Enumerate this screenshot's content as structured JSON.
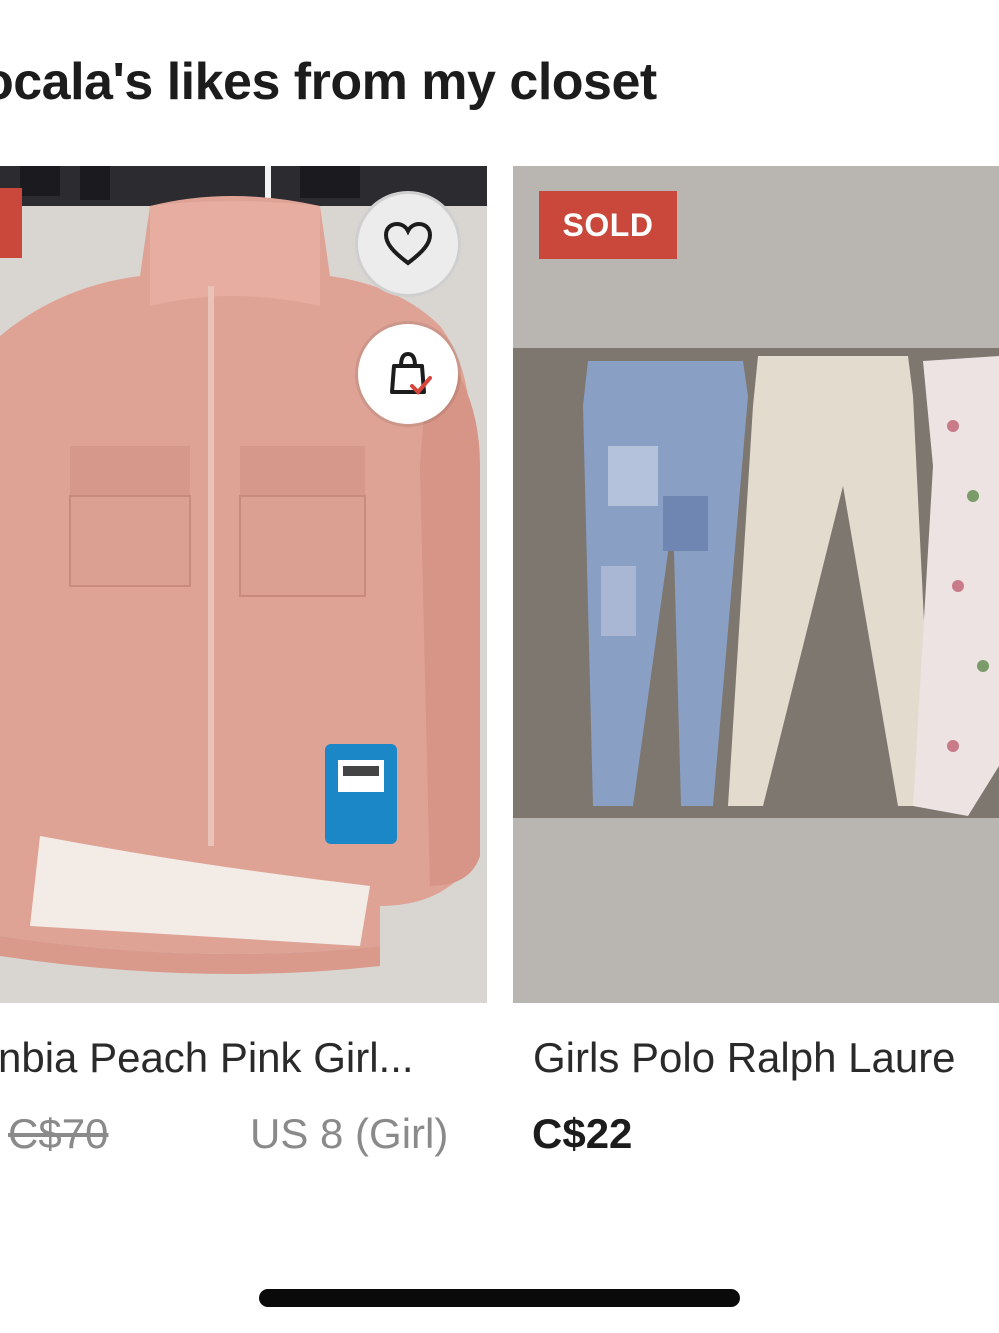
{
  "section": {
    "title": "ocala's likes from my closet"
  },
  "listings": [
    {
      "title": "nbia Peach Pink Girl...",
      "price": "C$70",
      "size": "US 8 (Girl)",
      "image_description": "pink jacket",
      "actions": {
        "like_icon": "heart-icon",
        "cart_icon": "shopping-bag-check-icon"
      }
    },
    {
      "badge": "SOLD",
      "title": "Girls Polo Ralph Laure",
      "price": "C$22",
      "image_description": "leggings"
    }
  ],
  "colors": {
    "sold_badge": "#c9483b",
    "jacket": "#dfa396",
    "background": "#ffffff"
  }
}
